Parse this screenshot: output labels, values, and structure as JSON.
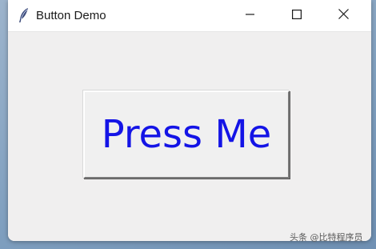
{
  "window": {
    "title": "Button Demo",
    "app_icon": "feather-icon",
    "controls": {
      "minimize_icon": "minimize-icon",
      "maximize_icon": "maximize-icon",
      "close_icon": "close-icon"
    }
  },
  "main": {
    "button_label": "Press Me",
    "button_text_color": "#1414e6"
  },
  "watermark": {
    "text": "头条 @比特程序员"
  }
}
